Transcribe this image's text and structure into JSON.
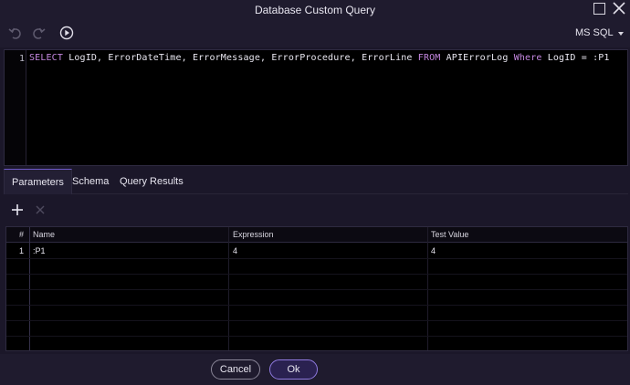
{
  "window": {
    "title": "Database Custom Query"
  },
  "toolbar": {
    "dialect": "MS SQL"
  },
  "editor": {
    "line_number": "1",
    "tokens": [
      {
        "text": "SELECT",
        "kind": "keyword"
      },
      {
        "text": " LogID, ErrorDateTime, ErrorMessage, ErrorProcedure, ErrorLine ",
        "kind": "text"
      },
      {
        "text": "FROM",
        "kind": "keyword"
      },
      {
        "text": " APIErrorLog ",
        "kind": "text"
      },
      {
        "text": "Where",
        "kind": "keyword"
      },
      {
        "text": " LogID = :P1",
        "kind": "text"
      }
    ]
  },
  "tabs": [
    {
      "label": "Parameters",
      "active": true
    },
    {
      "label": "Schema",
      "active": false
    },
    {
      "label": "Query Results",
      "active": false
    }
  ],
  "grid": {
    "headers": {
      "index": "#",
      "name": "Name",
      "expression": "Expression",
      "test_value": "Test Value"
    },
    "rows": [
      {
        "index": "1",
        "name": ":P1",
        "expression": "4",
        "test_value": "4"
      }
    ]
  },
  "footer": {
    "cancel_label": "Cancel",
    "ok_label": "Ok"
  },
  "colors": {
    "keyword": "#c487e0",
    "accent": "#8f7ae0",
    "background": "#1b1729"
  }
}
